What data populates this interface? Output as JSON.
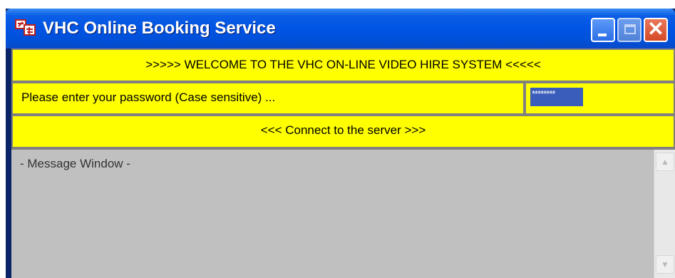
{
  "window": {
    "title": "VHC Online Booking Service",
    "icon": "app-logo-icon"
  },
  "titlebar_buttons": {
    "minimize_icon": "minimize-icon",
    "maximize_icon": "maximize-icon",
    "close_glyph": "✕"
  },
  "banner": {
    "text": ">>>>> WELCOME TO THE VHC ON-LINE VIDEO HIRE SYSTEM <<<<<"
  },
  "password": {
    "label": "Please enter your password (Case sensitive) ...",
    "masked_value": "********"
  },
  "connect": {
    "label": "<<< Connect to the server >>>"
  },
  "message_window": {
    "title": "- Message Window -"
  },
  "colors": {
    "panel_bg": "#ffff00",
    "titlebar": "#0054e3",
    "content_bg": "#c0c0c0",
    "selection": "#3a5dbb"
  }
}
